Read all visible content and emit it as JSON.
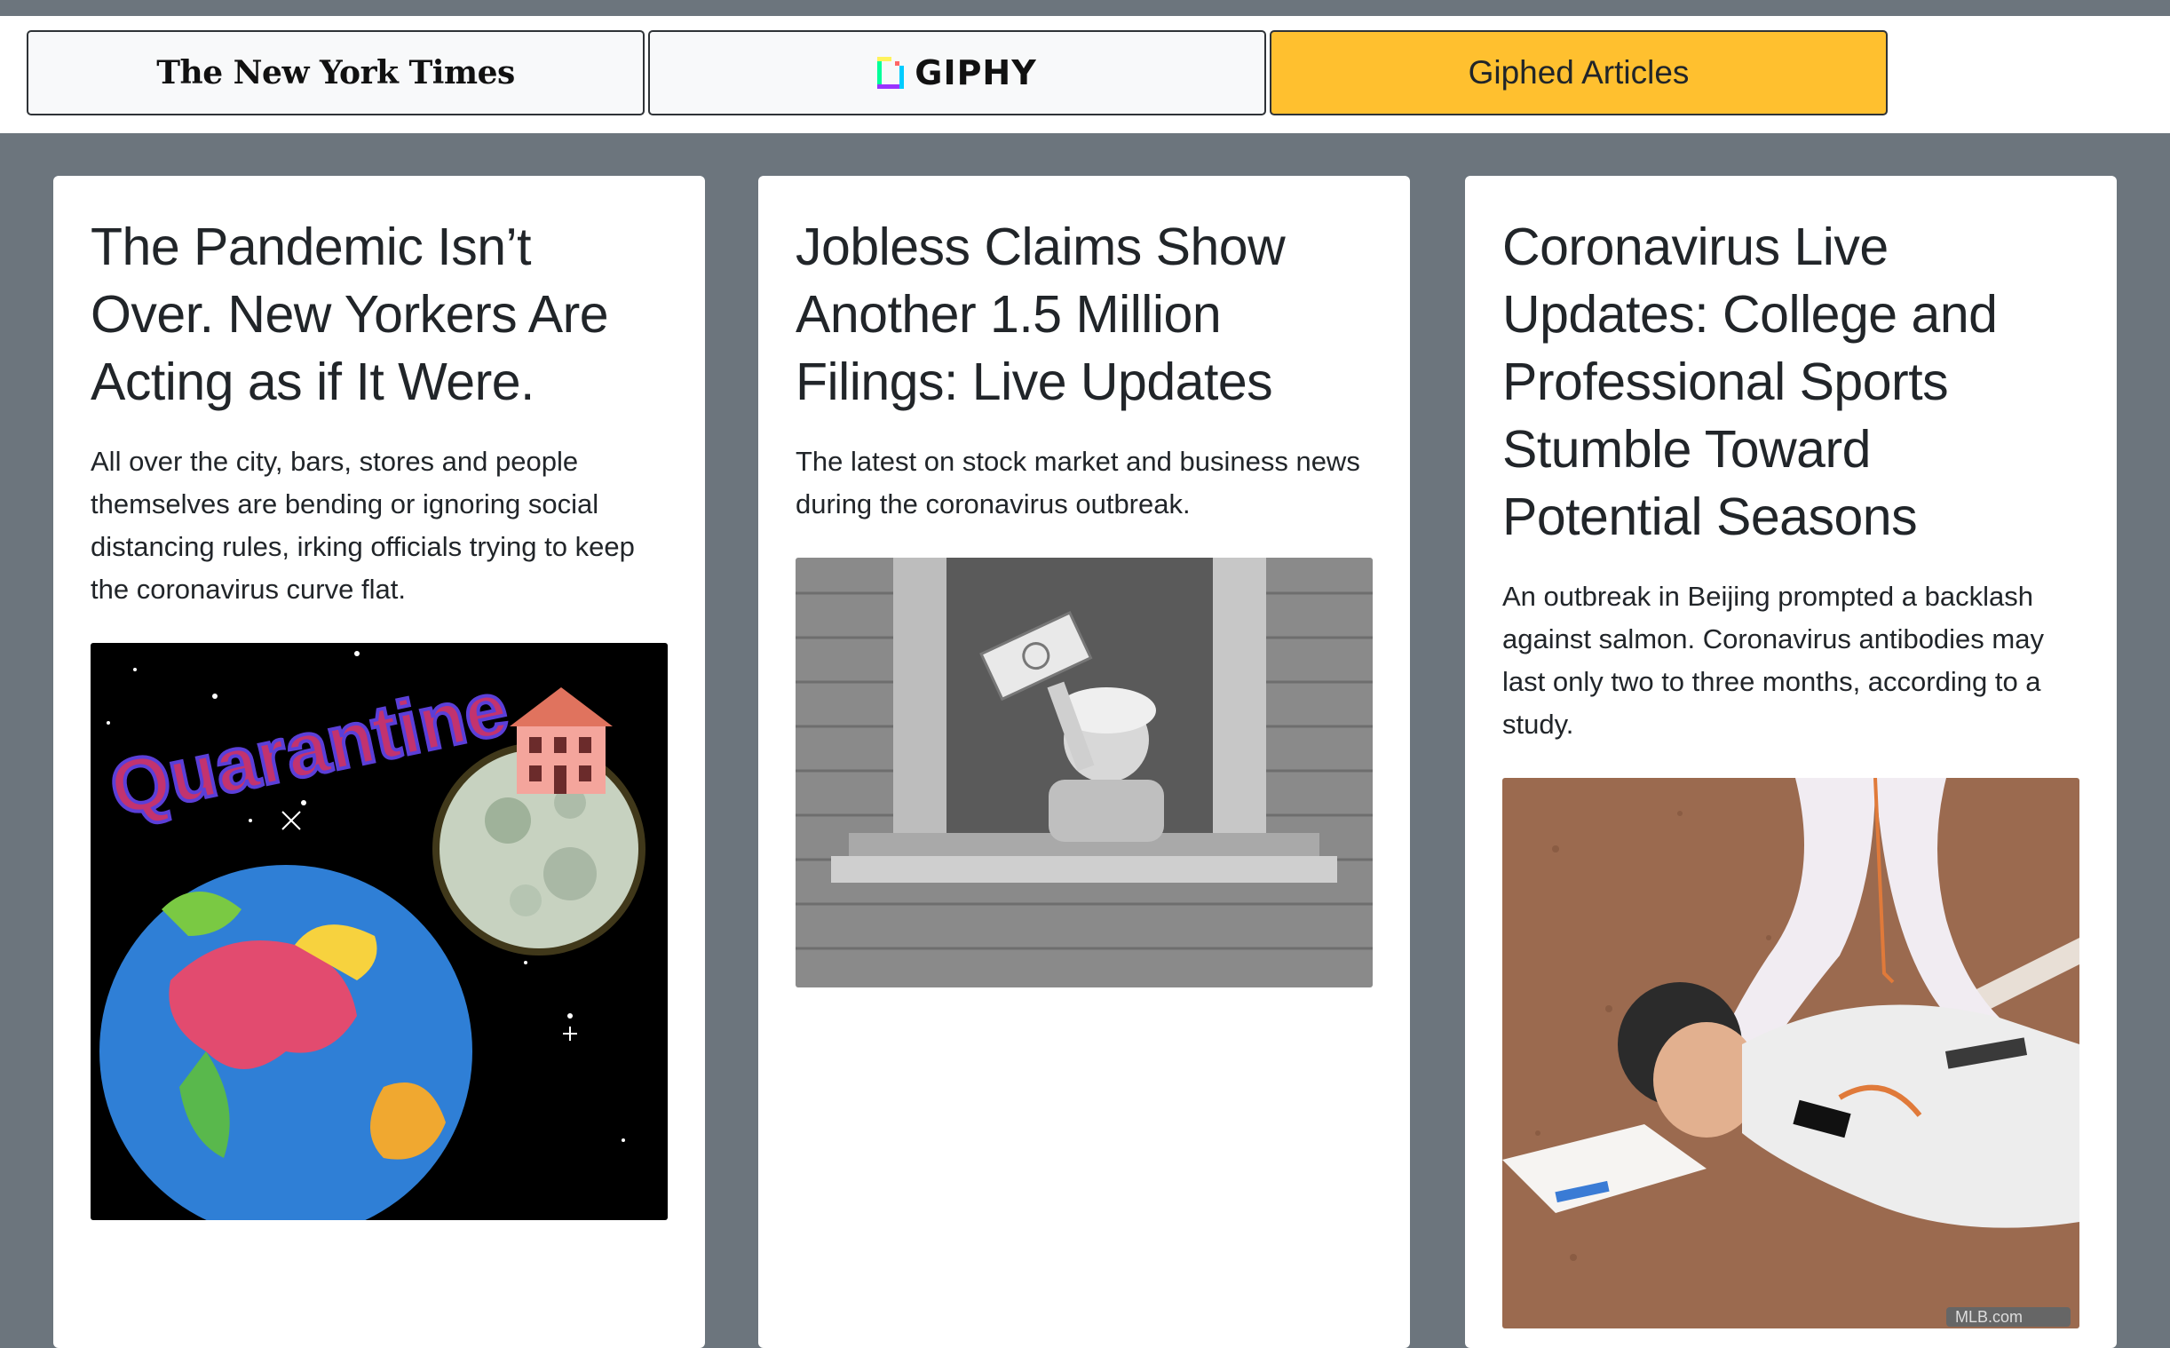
{
  "nav": {
    "nyt_logo": "The New York Times",
    "giphy_logo": "GIPHY",
    "giphed_label": "Giphed Articles"
  },
  "cards": [
    {
      "title": "The Pandemic Isn’t Over. New Yorkers Are Acting as if It Were.",
      "summary": "All over the city, bars, stores and people themselves are bending or ignoring social distancing rules, irking officials trying to keep the coronavirus curve flat.",
      "gif_text": "Quarantine"
    },
    {
      "title": "Jobless Claims Show Another 1.5 Million Filings: Live Updates",
      "summary": "The latest on stock market and business news during the coronavirus outbreak."
    },
    {
      "title": "Coronavirus Live Updates: College and Professional Sports Stumble Toward Potential Seasons",
      "summary": "An outbreak in Beijing prompted a backlash against salmon. Coronavirus antibodies may last only two to three months, according to a study.",
      "watermark": "MLB.com"
    }
  ],
  "colors": {
    "page_bg": "#6c757d",
    "active_tab": "#ffc02f",
    "text": "#212529"
  }
}
